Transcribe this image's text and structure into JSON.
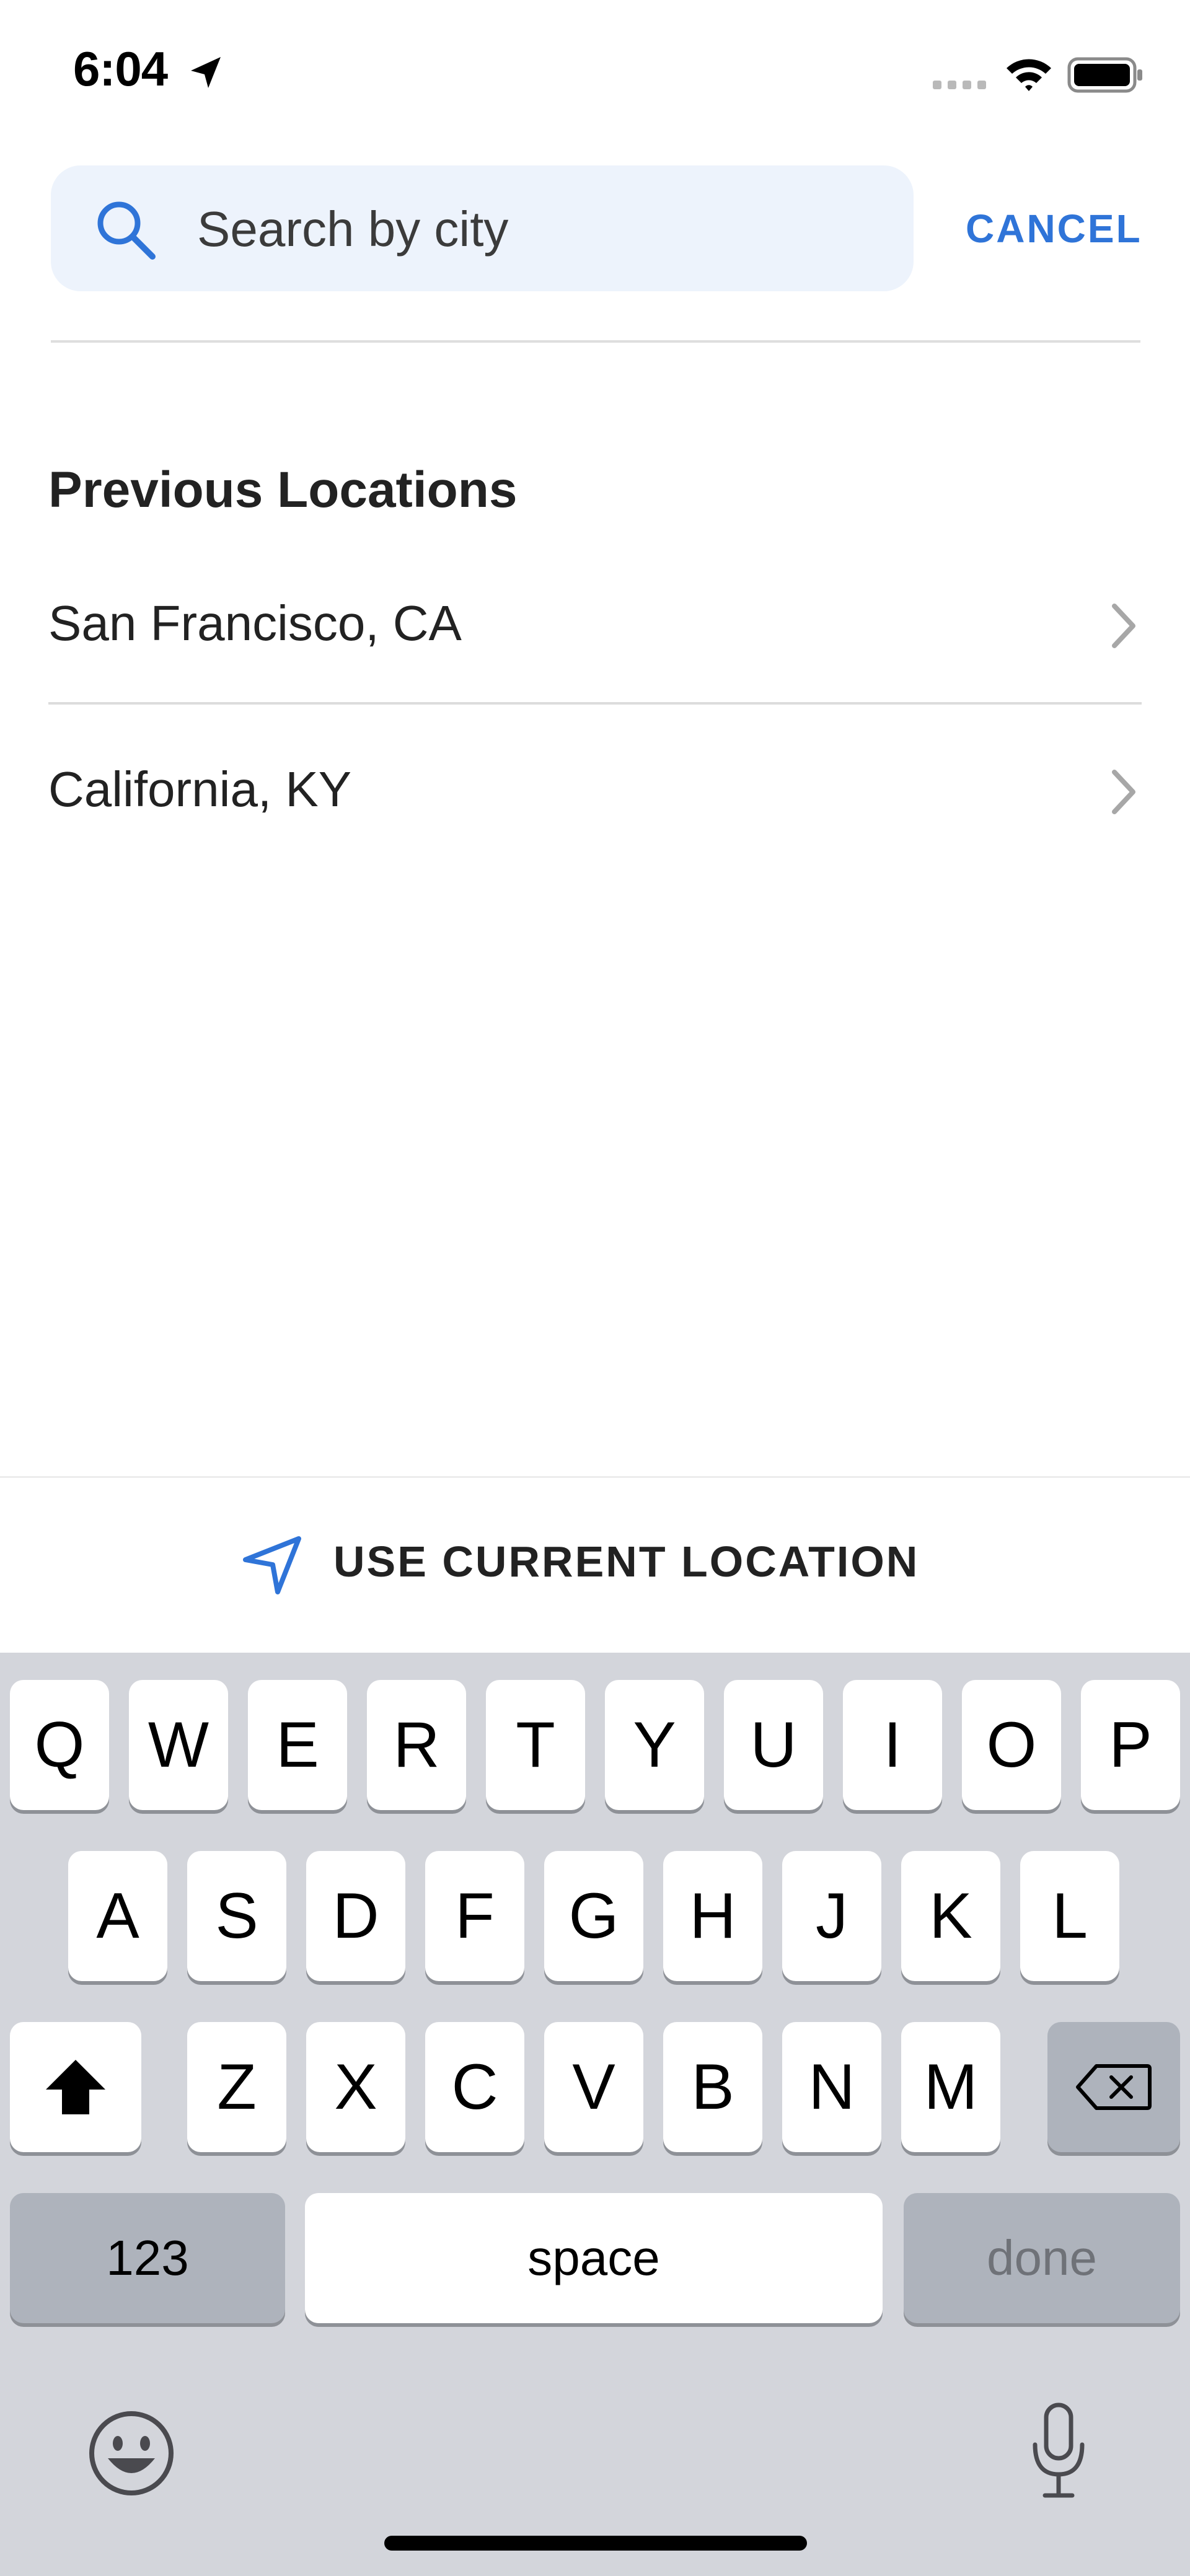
{
  "status_bar": {
    "time": "6:04"
  },
  "search": {
    "placeholder": "Search by city",
    "value": "",
    "cancel_label": "CANCEL"
  },
  "previous_locations": {
    "title": "Previous Locations",
    "items": [
      {
        "label": "San Francisco, CA"
      },
      {
        "label": "California, KY"
      }
    ]
  },
  "current_location": {
    "label": "USE CURRENT LOCATION"
  },
  "keyboard": {
    "row1": [
      "Q",
      "W",
      "E",
      "R",
      "T",
      "Y",
      "U",
      "I",
      "O",
      "P"
    ],
    "row2": [
      "A",
      "S",
      "D",
      "F",
      "G",
      "H",
      "J",
      "K",
      "L"
    ],
    "row3": [
      "Z",
      "X",
      "C",
      "V",
      "B",
      "N",
      "M"
    ],
    "numbers_label": "123",
    "space_label": "space",
    "done_label": "done"
  },
  "colors": {
    "accent": "#2f74d8",
    "search_bg": "#edf3fc",
    "keyboard_bg": "#d3d5db"
  },
  "icons": [
    "location-arrow-icon",
    "cellular-signal-icon",
    "wifi-icon",
    "battery-icon",
    "search-icon",
    "chevron-right-icon",
    "navigation-icon",
    "shift-icon",
    "backspace-icon",
    "emoji-icon",
    "microphone-icon"
  ]
}
